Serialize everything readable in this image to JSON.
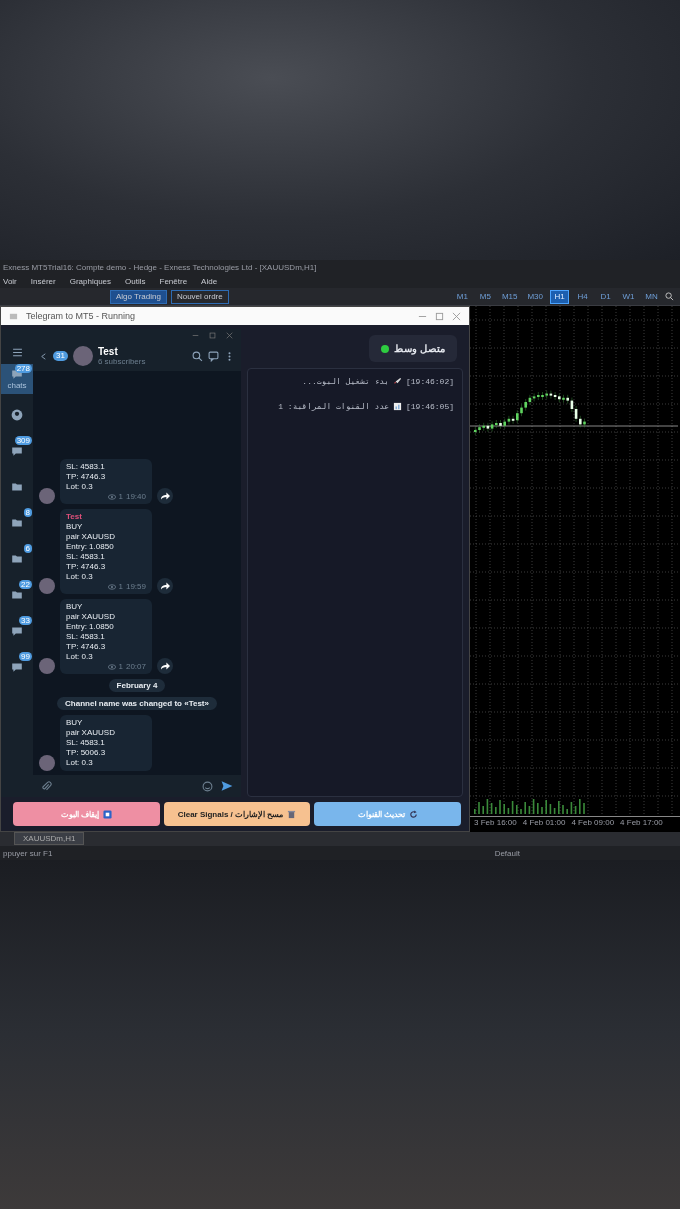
{
  "mt5": {
    "title": "Exness MT5Trial16: Compte demo - Hedge - Exness Technologies Ltd - [XAUUSDm,H1]",
    "menu": [
      "Voir",
      "Insérer",
      "Graphiques",
      "Outils",
      "Fenêtre",
      "Aide"
    ],
    "toolbar_buttons": [
      "Algo Trading",
      "Nouvel ordre"
    ],
    "timeframes": [
      {
        "label": "M1",
        "selected": false
      },
      {
        "label": "M5",
        "selected": false
      },
      {
        "label": "M15",
        "selected": false
      },
      {
        "label": "M30",
        "selected": false
      },
      {
        "label": "H1",
        "selected": true
      },
      {
        "label": "H4",
        "selected": false
      },
      {
        "label": "D1",
        "selected": false
      },
      {
        "label": "W1",
        "selected": false
      },
      {
        "label": "MN",
        "selected": false
      }
    ],
    "chart_xlabels": [
      "3 Feb 16:00",
      "4 Feb 01:00",
      "4 Feb 09:00",
      "4 Feb 17:00"
    ],
    "tabs": [
      {
        "label": "XAUUSDm,H1",
        "selected": true
      }
    ],
    "status_left": "ppuyer sur F1",
    "status_profile": "Default"
  },
  "app": {
    "title": "Telegram to MT5 - Running",
    "telegram": {
      "back_badge": "31",
      "channel": "Test",
      "subscribers": "6 subscribers",
      "folders": [
        {
          "label": "chats",
          "badge": "278",
          "selected": true,
          "kind": "chat"
        },
        {
          "selected": false,
          "kind": "person"
        },
        {
          "badge": "309",
          "selected": false,
          "kind": "chat"
        },
        {
          "selected": false,
          "kind": "folder"
        },
        {
          "badge": "8",
          "selected": false,
          "kind": "folder"
        },
        {
          "badge": "6",
          "selected": false,
          "kind": "folder"
        },
        {
          "badge": "22",
          "selected": false,
          "kind": "folder"
        },
        {
          "badge": "33",
          "selected": false,
          "kind": "chat"
        },
        {
          "badge": "99",
          "selected": false,
          "kind": "chat"
        }
      ],
      "messages": [
        {
          "kind": "post",
          "lines": [
            "SL: 4583.1",
            "TP: 4746.3",
            "Lot: 0.3"
          ],
          "views": "1",
          "time": "19:40"
        },
        {
          "kind": "post",
          "sender": "Test",
          "lines": [
            "BUY",
            "pair XAUUSD",
            "Entry: 1.0850",
            "SL: 4583.1",
            "TP: 4746.3",
            "Lot: 0.3"
          ],
          "views": "1",
          "time": "19:59"
        },
        {
          "kind": "post",
          "lines": [
            "BUY",
            "pair XAUUSD",
            "Entry: 1.0850",
            "SL: 4583.1",
            "TP: 4746.3",
            "Lot: 0.3"
          ],
          "views": "1",
          "time": "20:07"
        },
        {
          "kind": "date",
          "text": "February 4"
        },
        {
          "kind": "service",
          "text": "Channel name was changed to «Test»"
        },
        {
          "kind": "post",
          "lines": [
            "BUY",
            "pair XAUUSD",
            "SL: 4583.1",
            "TP: 5006.3",
            "Lot: 0.3"
          ]
        }
      ]
    },
    "status": {
      "text": "متصل وسط",
      "online": true
    },
    "log": [
      {
        "kind": "start",
        "time": "[19:46:02]",
        "text": "بدء تشغيل البوت..."
      },
      {
        "kind": "stats",
        "time": "[19:46:05]",
        "text": "عدد القنوات المراقبة: 1"
      }
    ],
    "buttons": [
      {
        "kind": "refresh",
        "label": "تحديث القنوات"
      },
      {
        "kind": "clear",
        "label": "Clear Signals / مسح الإشارات"
      },
      {
        "kind": "stop",
        "label": "إيقاف البوت"
      }
    ]
  }
}
